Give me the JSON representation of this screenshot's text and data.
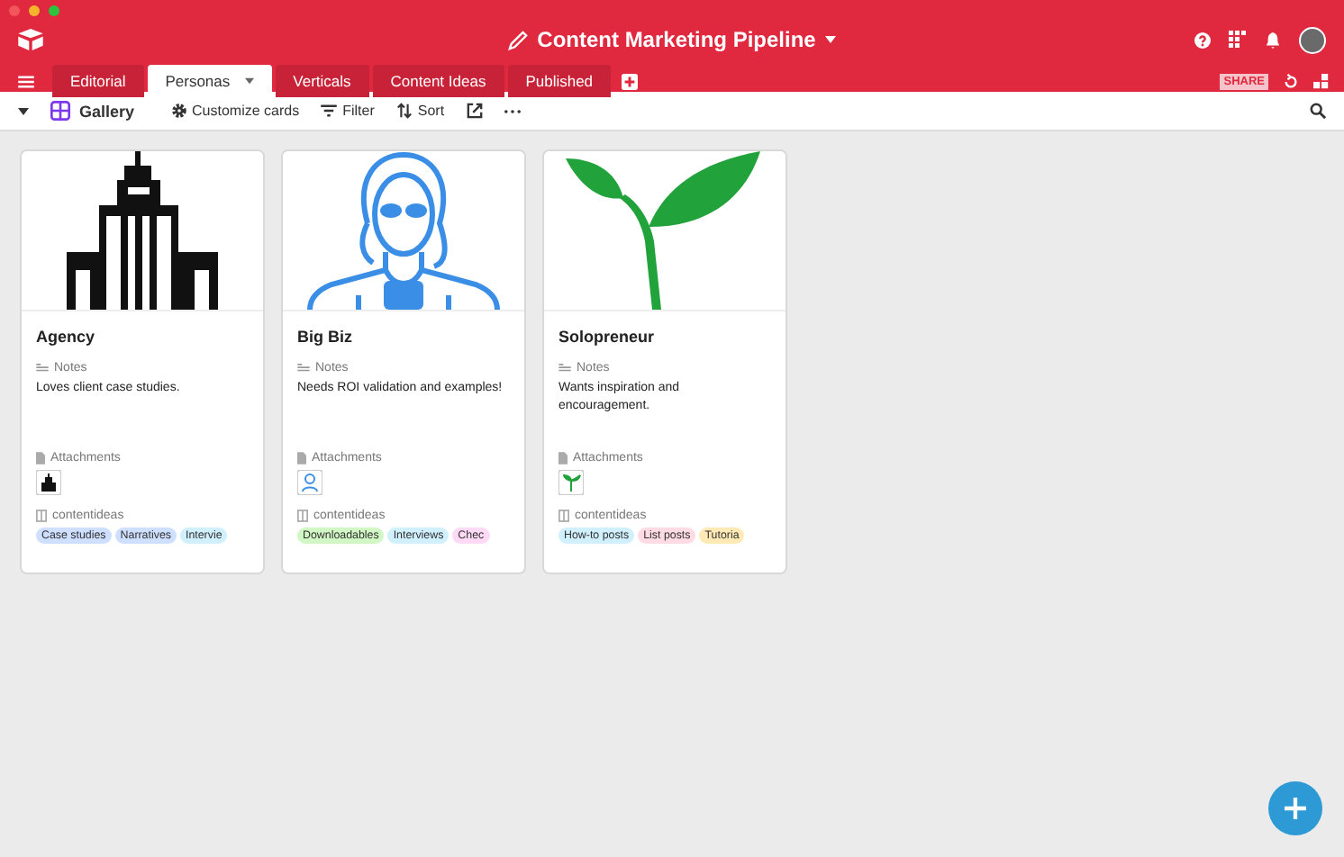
{
  "window": {
    "title": "Content Marketing Pipeline"
  },
  "tabs": [
    {
      "label": "Editorial",
      "selected": false
    },
    {
      "label": "Personas",
      "selected": true
    },
    {
      "label": "Verticals",
      "selected": false
    },
    {
      "label": "Content Ideas",
      "selected": false
    },
    {
      "label": "Published",
      "selected": false
    }
  ],
  "share_label": "SHARE",
  "toolbar": {
    "view": "Gallery",
    "customize": "Customize cards",
    "filter": "Filter",
    "sort": "Sort"
  },
  "cards": [
    {
      "kind": "building",
      "title": "Agency",
      "notes_label": "Notes",
      "notes": "Loves client case studies.",
      "attachments_label": "Attachments",
      "ideas_label": "contentideas",
      "tags": [
        {
          "text": "Case studies",
          "color": "#cfdfff"
        },
        {
          "text": "Narratives",
          "color": "#cfdfff"
        },
        {
          "text": "Intervie",
          "color": "#d0f0fd"
        }
      ]
    },
    {
      "kind": "person",
      "title": "Big Biz",
      "notes_label": "Notes",
      "notes": "Needs ROI validation and examples!",
      "attachments_label": "Attachments",
      "ideas_label": "contentideas",
      "tags": [
        {
          "text": "Downloadables",
          "color": "#d1f7c4"
        },
        {
          "text": "Interviews",
          "color": "#d0f0fd"
        },
        {
          "text": "Chec",
          "color": "#ffdaf6"
        }
      ]
    },
    {
      "kind": "sprout",
      "title": "Solopreneur",
      "notes_label": "Notes",
      "notes": "Wants inspiration and encouragement.",
      "attachments_label": "Attachments",
      "ideas_label": "contentideas",
      "tags": [
        {
          "text": "How-to posts",
          "color": "#d0f0fd"
        },
        {
          "text": "List posts",
          "color": "#ffdce5"
        },
        {
          "text": "Tutoria",
          "color": "#ffeab6"
        }
      ]
    }
  ]
}
